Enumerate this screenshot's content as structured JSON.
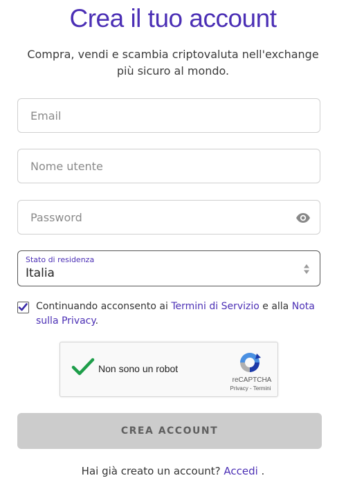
{
  "header": {
    "title": "Crea il tuo account",
    "subtitle": "Compra, vendi e scambia criptovaluta nell'exchange più sicuro al mondo."
  },
  "form": {
    "email_placeholder": "Email",
    "username_placeholder": "Nome utente",
    "password_placeholder": "Password",
    "residence_label": "Stato di residenza",
    "residence_value": "Italia",
    "consent_prefix": "Continuando acconsento ai ",
    "terms_link": "Termini di Servizio",
    "consent_middle": " e alla ",
    "privacy_link": "Nota sulla Privacy",
    "consent_suffix": ".",
    "consent_checked": true,
    "submit_label": "CREA ACCOUNT"
  },
  "captcha": {
    "label": "Non sono un robot",
    "brand": "reCAPTCHA",
    "links": "Privacy - Termini",
    "checked": true
  },
  "footer": {
    "prompt": "Hai già creato un account? ",
    "login_link": "Accedi",
    "suffix": " ."
  },
  "colors": {
    "accent": "#4b2fb5",
    "captcha_check": "#1e9e4a",
    "button_disabled": "#cccccc"
  },
  "icons": {
    "password_toggle": "eye-icon",
    "select_arrows": "sort-arrows-icon",
    "consent_checkbox": "checkmark-icon",
    "captcha_logo": "recaptcha-logo-icon"
  }
}
